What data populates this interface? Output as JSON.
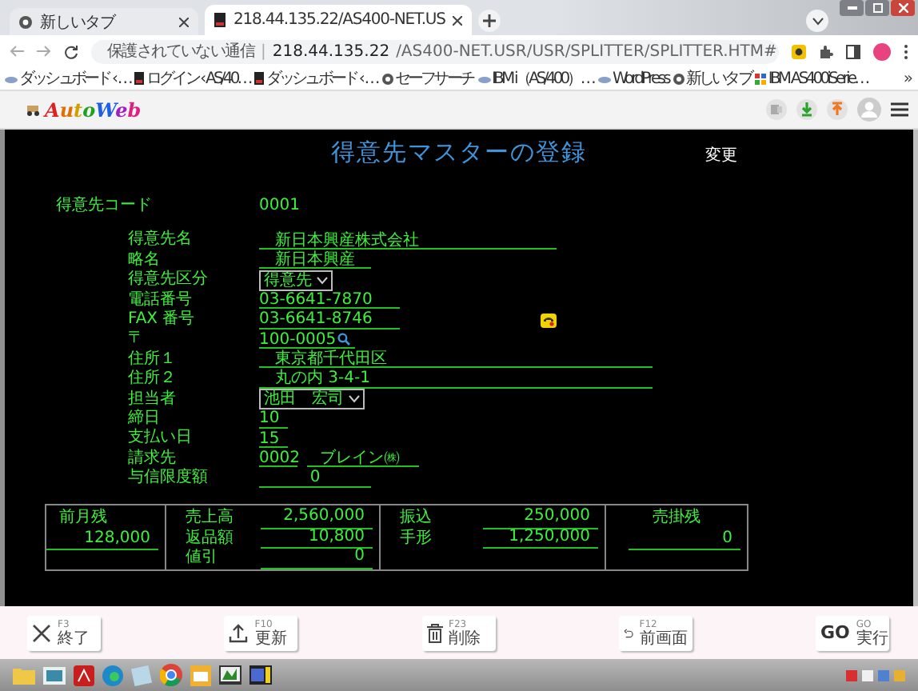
{
  "browser": {
    "tabs": [
      {
        "title": "新しいタブ",
        "selected": false
      },
      {
        "title": "218.44.135.22/AS400-NET.US",
        "selected": true
      }
    ],
    "address": {
      "security": "保護されていない通信",
      "separator": "|",
      "host": "218.44.135.22",
      "path": "/AS400-NET.USR/USR/SPLITTER/SPLITTER.HTM#"
    },
    "bookmarks": [
      {
        "title": "ダッシュボード ‹ …",
        "kind": "cloud"
      },
      {
        "title": "ログイン ‹ AS/40…",
        "kind": "terminal"
      },
      {
        "title": "ダッシュボード ‹ …",
        "kind": "terminal"
      },
      {
        "title": "セーフサーチ",
        "kind": "globe"
      },
      {
        "title": "IBM i（AS/400）…",
        "kind": "cloud"
      },
      {
        "title": "WordPress",
        "kind": "cloud"
      },
      {
        "title": "新しいタブ",
        "kind": "globe"
      },
      {
        "title": "IBM AS400iSerie…",
        "kind": "puzzle"
      }
    ],
    "bookmarks_more": "»"
  },
  "app": {
    "logo": "AutoWeb"
  },
  "screen": {
    "title": "得意先マスターの登録",
    "mode": "変更",
    "code_label": "得意先コード",
    "code_value": "0001"
  },
  "fields": [
    {
      "label": "得意先名",
      "kind": "text",
      "value": "新日本興産株式会社"
    },
    {
      "label": "略名",
      "kind": "text",
      "value": "新日本興産"
    },
    {
      "label": "得意先区分",
      "kind": "select",
      "value": "得意先"
    },
    {
      "label": "電話番号",
      "kind": "text",
      "value": "03-6641-7870"
    },
    {
      "label": "FAX 番号",
      "kind": "text",
      "value": "03-6641-8746"
    },
    {
      "label": "〒",
      "kind": "search",
      "value": "100-0005"
    },
    {
      "label": "住所１",
      "kind": "text",
      "value": "東京都千代田区"
    },
    {
      "label": "住所２",
      "kind": "text",
      "value": "丸の内 3-4-1"
    },
    {
      "label": "担当者",
      "kind": "select",
      "value": "池田　宏司"
    },
    {
      "label": "締日",
      "kind": "text",
      "value": "10"
    },
    {
      "label": "支払い日",
      "kind": "text",
      "value": "15"
    },
    {
      "label": "請求先",
      "kind": "pair",
      "values": [
        "0002",
        "ブレイン㈱"
      ]
    },
    {
      "label": "与信限度額",
      "kind": "amount",
      "value": "0"
    }
  ],
  "summary": [
    {
      "kind": "stacked",
      "label": "前月残",
      "value": "128,000"
    },
    {
      "kind": "rows",
      "rows": [
        {
          "label": "売上高",
          "value": "2,560,000"
        },
        {
          "label": "返品額",
          "value": "10,800"
        },
        {
          "label": "値引",
          "value": "0"
        }
      ]
    },
    {
      "kind": "rows",
      "rows": [
        {
          "label": "振込",
          "value": "250,000"
        },
        {
          "label": "手形",
          "value": "1,250,000"
        }
      ]
    },
    {
      "kind": "stacked",
      "label": "売掛残",
      "value": "0"
    }
  ],
  "footer_buttons": [
    {
      "key": "F3",
      "label": "終了",
      "kind": "icon"
    },
    {
      "key": "F10",
      "label": "更新",
      "kind": "icon"
    },
    {
      "key": "F23",
      "label": "削除",
      "kind": "icon"
    },
    {
      "key": "F12",
      "label": "前画面",
      "kind": "icon"
    },
    {
      "key": "GO",
      "label": "実行",
      "kind": "glyph",
      "glyph": "GO"
    }
  ]
}
